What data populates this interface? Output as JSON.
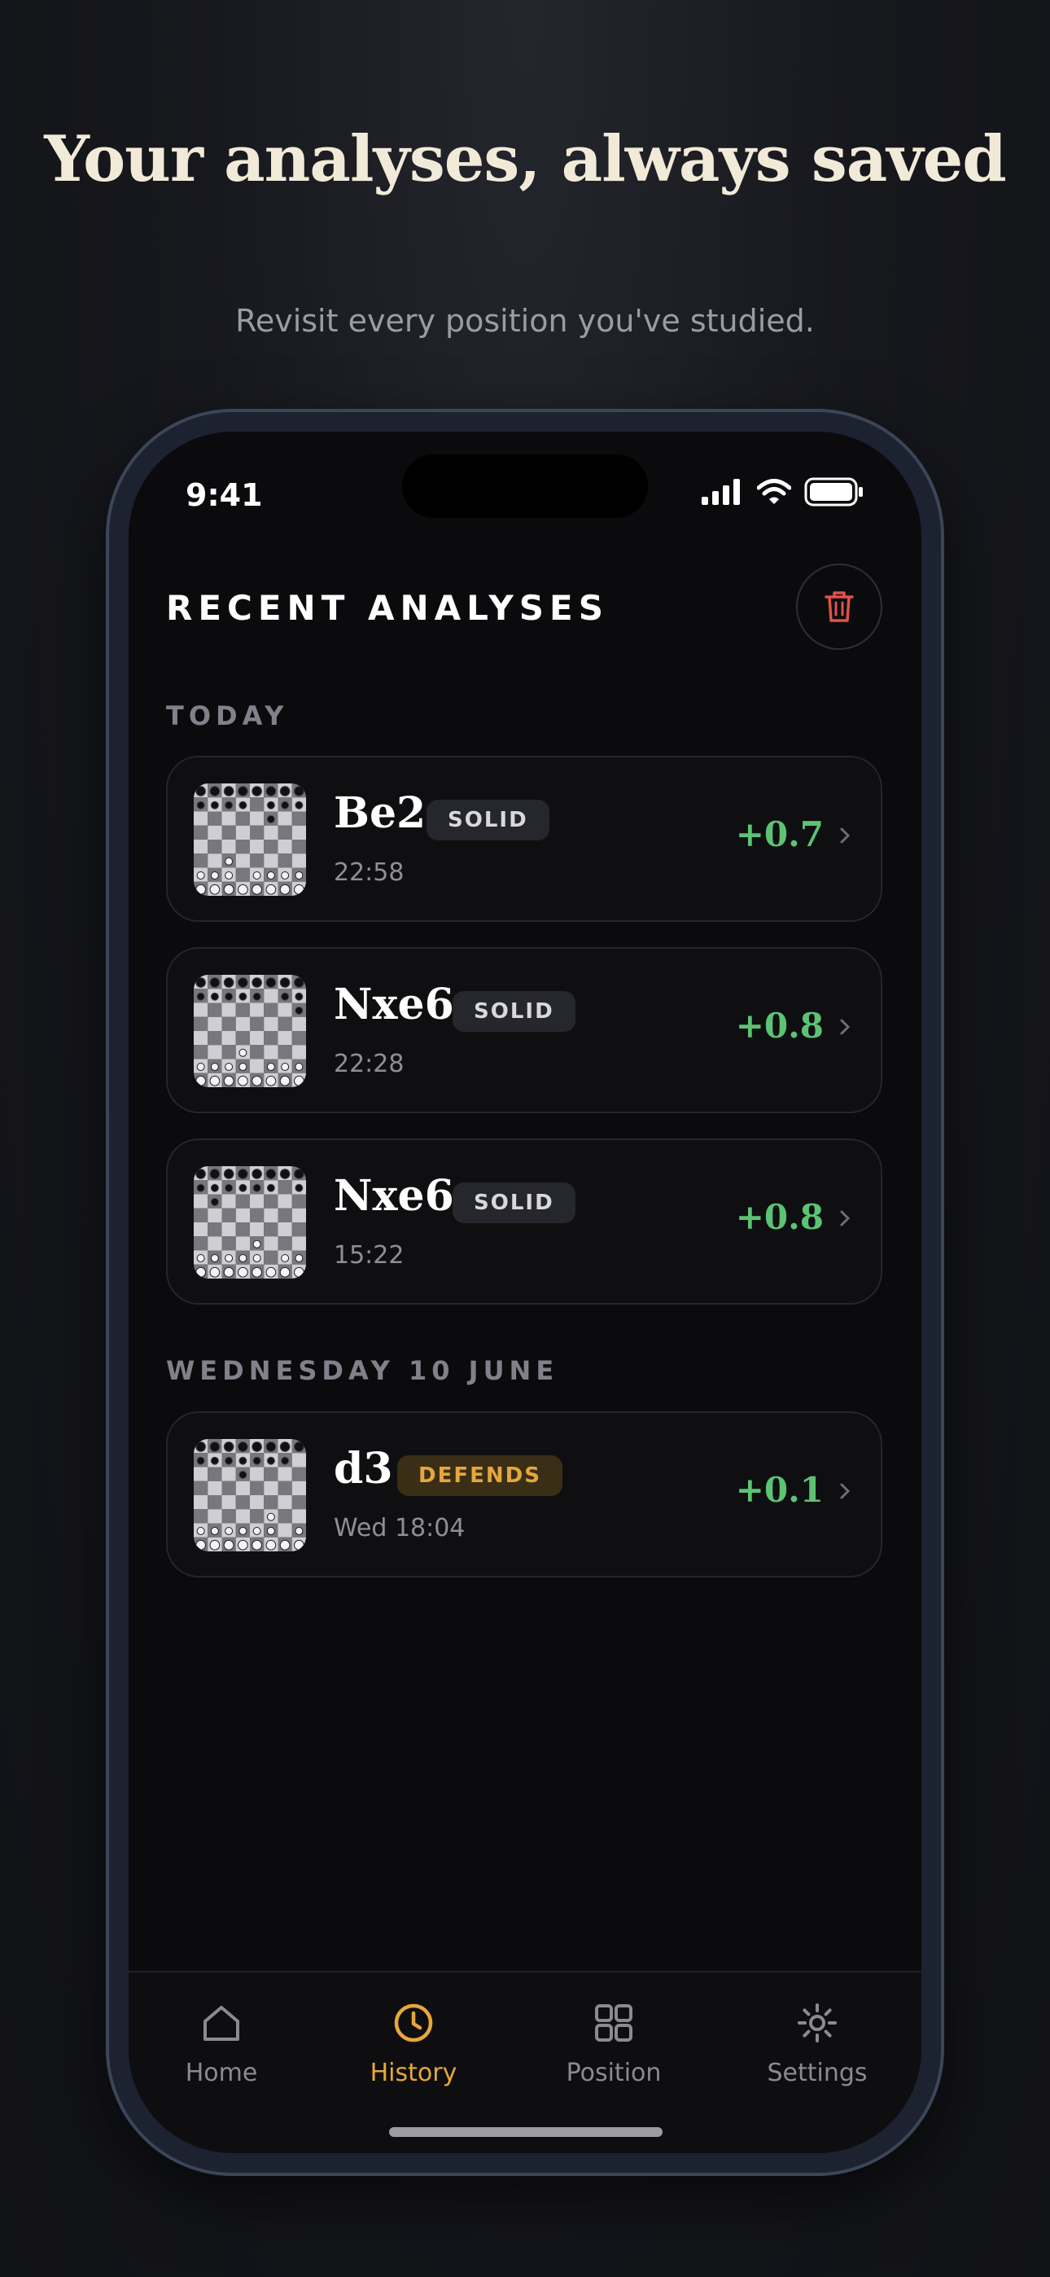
{
  "headline": "Your analyses, always saved",
  "subheadline": "Revisit every position you've studied.",
  "status_bar": {
    "time": "9:41"
  },
  "screen_title": "RECENT ANALYSES",
  "sections": [
    {
      "label": "TODAY",
      "items": [
        {
          "move": "Be2",
          "badge": "SOLID",
          "time": "22:58",
          "score": "+0.7"
        },
        {
          "move": "Nxe6",
          "badge": "SOLID",
          "time": "22:28",
          "score": "+0.8"
        },
        {
          "move": "Nxe6",
          "badge": "SOLID",
          "time": "15:22",
          "score": "+0.8"
        }
      ]
    },
    {
      "label": "WEDNESDAY 10 JUNE",
      "items": [
        {
          "move": "d3",
          "badge": "DEFENDS",
          "time": "Wed 18:04",
          "score": "+0.1"
        }
      ]
    }
  ],
  "tabs": [
    {
      "label": "Home",
      "icon": "home-icon",
      "active": false
    },
    {
      "label": "History",
      "icon": "clock-icon",
      "active": true
    },
    {
      "label": "Position",
      "icon": "grid-icon",
      "active": false
    },
    {
      "label": "Settings",
      "icon": "gear-icon",
      "active": false
    }
  ],
  "colors": {
    "accent": "#e6a73a",
    "positive": "#5cc374",
    "danger": "#e0524a",
    "background": "#0b0b0d"
  }
}
